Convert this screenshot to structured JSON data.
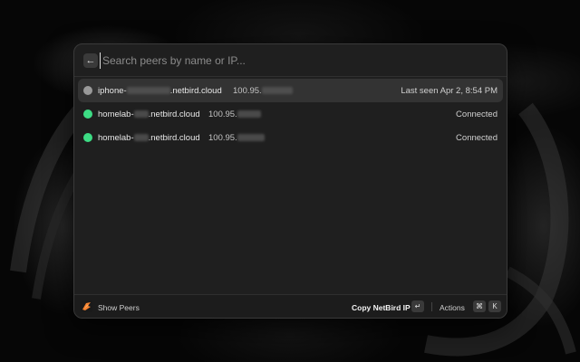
{
  "search": {
    "placeholder": "Search peers by name or IP..."
  },
  "peers": [
    {
      "name_prefix": "iphone-",
      "name_suffix": ".netbird.cloud",
      "ip_prefix": "100.95.",
      "status": "Last seen Apr 2, 8:54 PM",
      "status_color": "#9a9a9a",
      "selected": true
    },
    {
      "name_prefix": "homelab-",
      "name_suffix": ".netbird.cloud",
      "ip_prefix": "100.95.",
      "status": "Connected",
      "status_color": "#3ddc84",
      "selected": false
    },
    {
      "name_prefix": "homelab-",
      "name_suffix": ".netbird.cloud",
      "ip_prefix": "100.95.",
      "status": "Connected",
      "status_color": "#3ddc84",
      "selected": false
    }
  ],
  "footer": {
    "title": "Show Peers",
    "primary_action": "Copy NetBird IP",
    "primary_key": "↵",
    "actions_label": "Actions",
    "actions_key_mod": "⌘",
    "actions_key": "K"
  },
  "colors": {
    "accent_orange": "#f68330",
    "connected": "#3ddc84",
    "offline": "#9a9a9a"
  },
  "icons": {
    "back": "arrow-left-icon",
    "logo": "netbird-logo-icon"
  }
}
